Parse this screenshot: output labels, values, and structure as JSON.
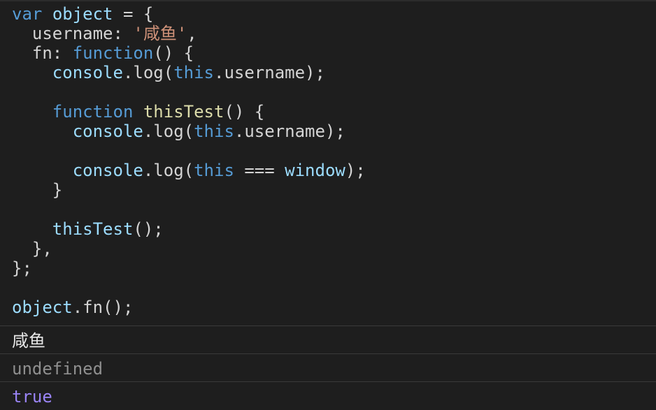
{
  "editor": {
    "lines": [
      {
        "tokens": [
          {
            "t": "var",
            "c": "kw"
          },
          {
            "t": " ",
            "c": "plain"
          },
          {
            "t": "object",
            "c": "ident"
          },
          {
            "t": " = {",
            "c": "plain"
          }
        ]
      },
      {
        "tokens": [
          {
            "t": "  username: ",
            "c": "plain"
          },
          {
            "t": "'咸鱼'",
            "c": "str"
          },
          {
            "t": ",",
            "c": "plain"
          }
        ]
      },
      {
        "tokens": [
          {
            "t": "  fn: ",
            "c": "plain"
          },
          {
            "t": "function",
            "c": "kw"
          },
          {
            "t": "() {",
            "c": "plain"
          }
        ]
      },
      {
        "tokens": [
          {
            "t": "    ",
            "c": "plain"
          },
          {
            "t": "console",
            "c": "ident"
          },
          {
            "t": ".log(",
            "c": "plain"
          },
          {
            "t": "this",
            "c": "kw"
          },
          {
            "t": ".username);",
            "c": "plain"
          }
        ]
      },
      {
        "tokens": []
      },
      {
        "tokens": [
          {
            "t": "    ",
            "c": "plain"
          },
          {
            "t": "function",
            "c": "kw"
          },
          {
            "t": " ",
            "c": "plain"
          },
          {
            "t": "thisTest",
            "c": "fn"
          },
          {
            "t": "() {",
            "c": "plain"
          }
        ]
      },
      {
        "tokens": [
          {
            "t": "      ",
            "c": "plain"
          },
          {
            "t": "console",
            "c": "ident"
          },
          {
            "t": ".log(",
            "c": "plain"
          },
          {
            "t": "this",
            "c": "kw"
          },
          {
            "t": ".username);",
            "c": "plain"
          }
        ]
      },
      {
        "tokens": []
      },
      {
        "tokens": [
          {
            "t": "      ",
            "c": "plain"
          },
          {
            "t": "console",
            "c": "ident"
          },
          {
            "t": ".log(",
            "c": "plain"
          },
          {
            "t": "this",
            "c": "kw"
          },
          {
            "t": " === ",
            "c": "plain"
          },
          {
            "t": "window",
            "c": "ident"
          },
          {
            "t": ");",
            "c": "plain"
          }
        ]
      },
      {
        "tokens": [
          {
            "t": "    }",
            "c": "plain"
          }
        ]
      },
      {
        "tokens": []
      },
      {
        "tokens": [
          {
            "t": "    ",
            "c": "plain"
          },
          {
            "t": "thisTest",
            "c": "ident"
          },
          {
            "t": "();",
            "c": "plain"
          }
        ]
      },
      {
        "tokens": [
          {
            "t": "  },",
            "c": "plain"
          }
        ]
      },
      {
        "tokens": [
          {
            "t": "};",
            "c": "plain"
          }
        ]
      },
      {
        "tokens": []
      },
      {
        "tokens": [
          {
            "t": "object",
            "c": "ident"
          },
          {
            "t": ".fn();",
            "c": "plain"
          }
        ]
      }
    ]
  },
  "console": {
    "outputs": [
      {
        "text": "咸鱼",
        "type": "out-cn"
      },
      {
        "text": "undefined",
        "type": "out-undefined"
      },
      {
        "text": "true",
        "type": "out-true"
      }
    ]
  }
}
